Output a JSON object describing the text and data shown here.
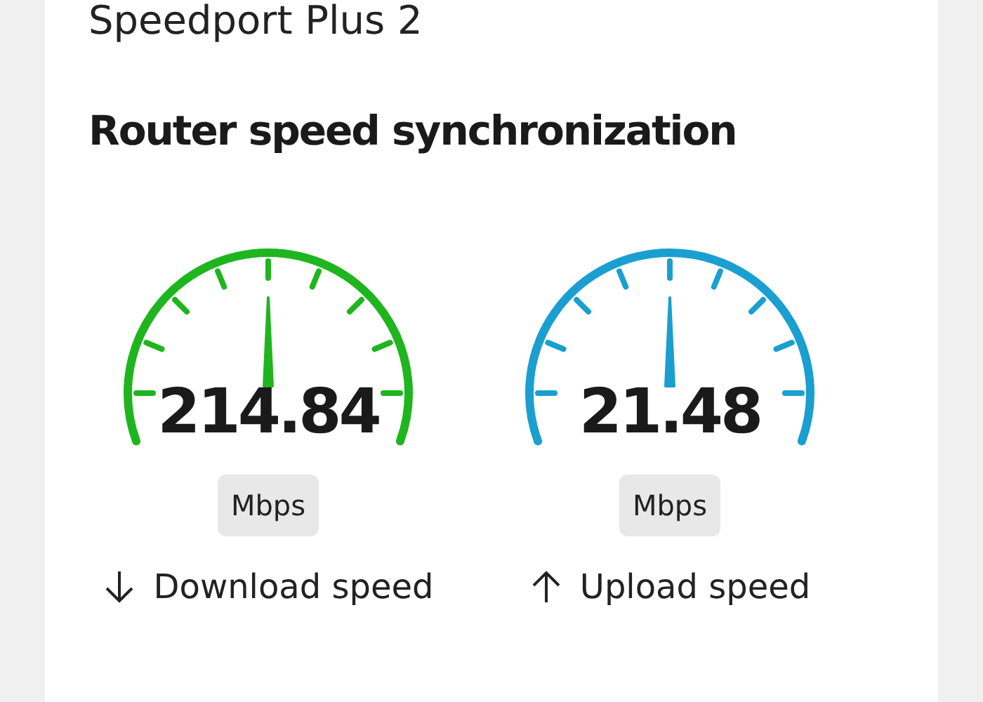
{
  "device_title": "Speedport Plus 2",
  "section_title": "Router speed synchronization",
  "gauges": [
    {
      "value": "214.84",
      "unit": "Mbps",
      "label": "Download speed",
      "kind": "download",
      "color": "#1fb51f"
    },
    {
      "value": "21.48",
      "unit": "Mbps",
      "label": "Upload speed",
      "kind": "upload",
      "color": "#1a9fd0"
    }
  ]
}
